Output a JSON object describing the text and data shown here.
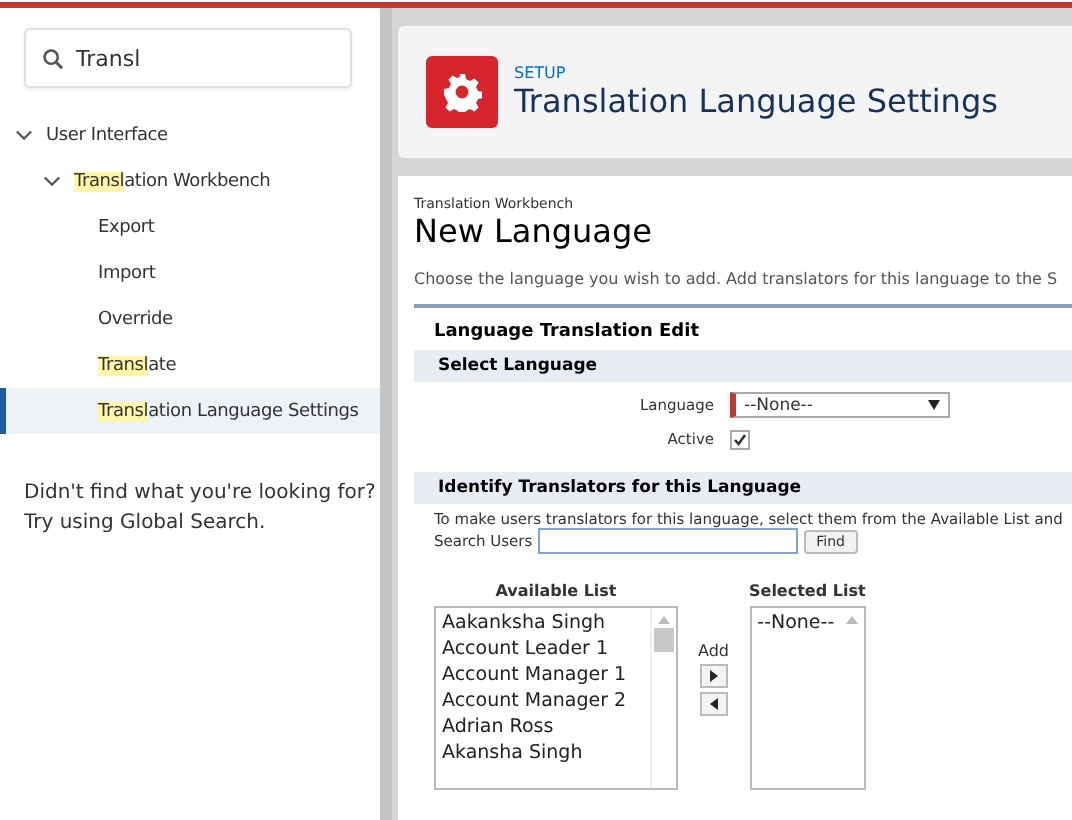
{
  "search": {
    "value": "Transl"
  },
  "tree": [
    {
      "label": "User Interface",
      "highlighted": false,
      "expanded": true,
      "selected": false,
      "children": [
        {
          "label": "Translation Workbench",
          "highlighted": true,
          "expanded": true,
          "selected": false,
          "children": [
            {
              "label": "Export",
              "highlighted": false,
              "selected": false
            },
            {
              "label": "Import",
              "highlighted": false,
              "selected": false
            },
            {
              "label": "Override",
              "highlighted": false,
              "selected": false
            },
            {
              "label": "Translate",
              "highlighted": true,
              "selected": false
            },
            {
              "label": "Translation Language Settings",
              "highlighted": true,
              "selected": true
            }
          ]
        }
      ]
    }
  ],
  "sidebar_footer": [
    "Didn't find what you're looking for?",
    "Try using Global Search."
  ],
  "header": {
    "eyebrow": "SETUP",
    "title": "Translation Language Settings"
  },
  "page": {
    "breadcrumb": "Translation Workbench",
    "title": "New Language",
    "description": "Choose the language you wish to add. Add translators for this language to the S"
  },
  "block": {
    "title": "Language Translation Edit"
  },
  "select_section": {
    "title": "Select Language",
    "language_label": "Language",
    "language_value": "--None--",
    "active_label": "Active",
    "active_checked": true
  },
  "translators_section": {
    "title": "Identify Translators for this Language",
    "description": "To make users translators for this language, select them from the Available List and",
    "search_label": "Search Users",
    "find_button": "Find"
  },
  "available_list": {
    "title": "Available List",
    "items": [
      "Aakanksha Singh",
      "Account Leader 1",
      "Account Manager 1",
      "Account Manager 2",
      "Adrian Ross",
      "Akansha Singh"
    ]
  },
  "add_label": "Add",
  "selected_list": {
    "title": "Selected List",
    "items": [
      "--None--"
    ]
  }
}
